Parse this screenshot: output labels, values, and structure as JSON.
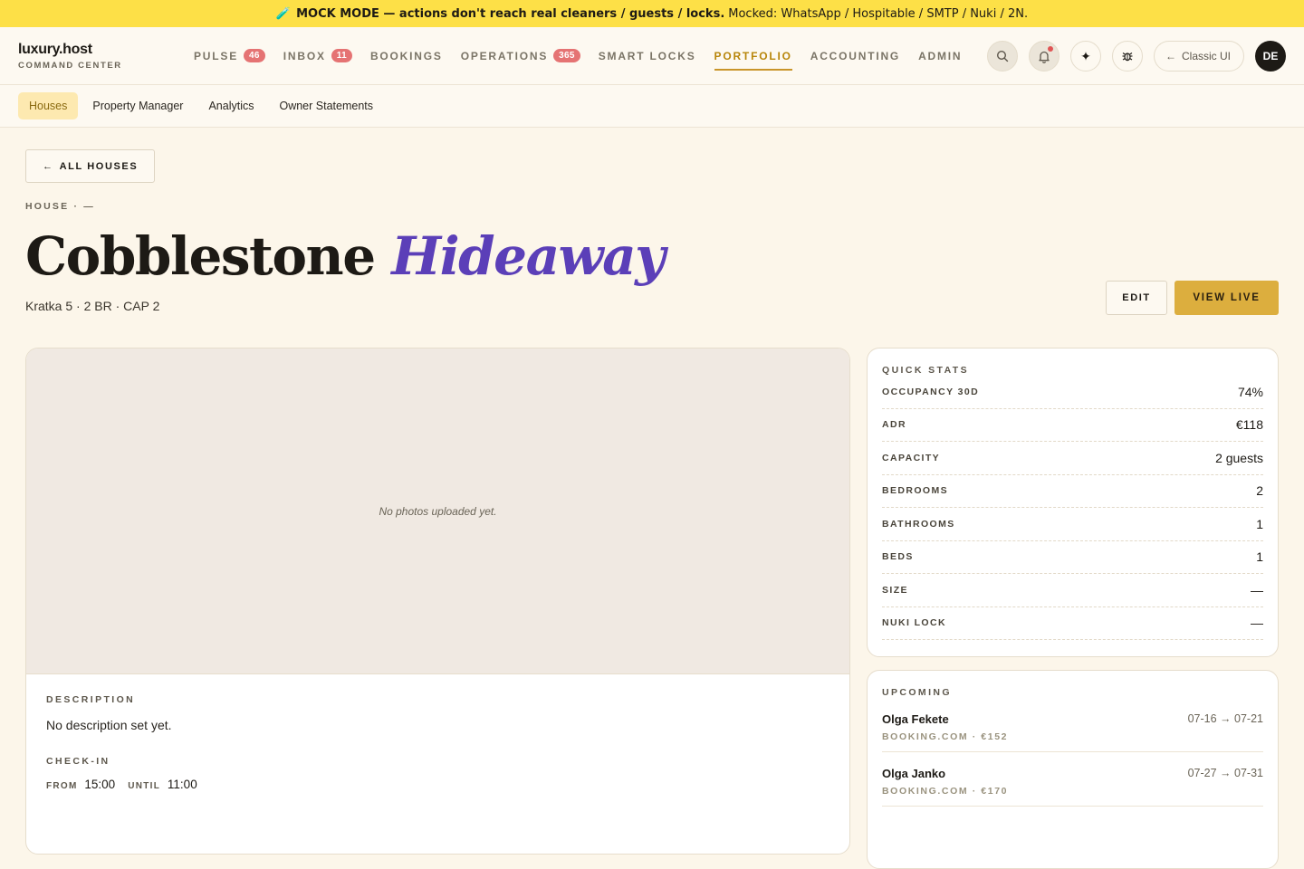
{
  "banner": {
    "icon": "test-tube-icon",
    "strong": "MOCK MODE — actions don't reach real cleaners / guests / locks.",
    "rest": "Mocked: WhatsApp / Hospitable / SMTP / Nuki / 2N."
  },
  "brand": {
    "name": "luxury.host",
    "sub": "COMMAND CENTER"
  },
  "nav": {
    "items": [
      {
        "label": "PULSE",
        "badge": "46"
      },
      {
        "label": "INBOX",
        "badge": "11"
      },
      {
        "label": "BOOKINGS"
      },
      {
        "label": "OPERATIONS",
        "badge": "365"
      },
      {
        "label": "SMART LOCKS"
      },
      {
        "label": "PORTFOLIO",
        "active": true
      },
      {
        "label": "ACCOUNTING"
      },
      {
        "label": "ADMIN"
      }
    ],
    "classic_label": "Classic UI",
    "avatar": "DE"
  },
  "subnav": {
    "items": [
      {
        "label": "Houses",
        "active": true
      },
      {
        "label": "Property Manager"
      },
      {
        "label": "Analytics"
      },
      {
        "label": "Owner Statements"
      }
    ]
  },
  "page": {
    "back_label": "ALL HOUSES",
    "eyebrow": "HOUSE · —",
    "title_main": "Cobblestone",
    "title_accent": "Hideaway",
    "subtitle": "Kratka 5 · 2 BR · CAP 2",
    "edit_label": "EDIT",
    "view_live_label": "VIEW LIVE"
  },
  "main_card": {
    "photo_placeholder": "No photos uploaded yet.",
    "description_label": "DESCRIPTION",
    "description": "No description set yet.",
    "checkin_label": "CHECK-IN",
    "from_label": "FROM",
    "from_value": "15:00",
    "until_label": "UNTIL",
    "until_value": "11:00"
  },
  "quick_stats": {
    "title": "QUICK STATS",
    "rows": [
      {
        "key": "OCCUPANCY 30D",
        "value": "74%"
      },
      {
        "key": "ADR",
        "value": "€118"
      },
      {
        "key": "CAPACITY",
        "value": "2 guests"
      },
      {
        "key": "BEDROOMS",
        "value": "2"
      },
      {
        "key": "BATHROOMS",
        "value": "1"
      },
      {
        "key": "BEDS",
        "value": "1"
      },
      {
        "key": "SIZE",
        "value": "—"
      },
      {
        "key": "NUKI LOCK",
        "value": "—"
      }
    ]
  },
  "upcoming": {
    "title": "UPCOMING",
    "items": [
      {
        "name": "Olga Fekete",
        "meta": "BOOKING.COM · €152",
        "dates": "07-16 → 07-21"
      },
      {
        "name": "Olga Janko",
        "meta": "BOOKING.COM · €170",
        "dates": "07-27 → 07-31"
      }
    ]
  }
}
